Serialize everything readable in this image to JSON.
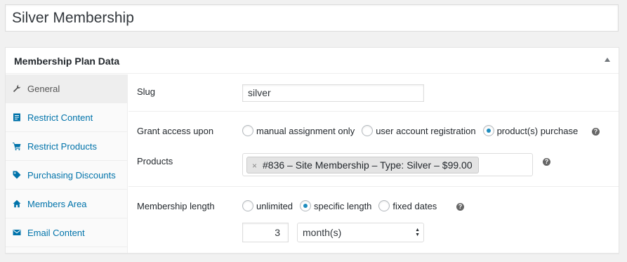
{
  "post_title": "Silver Membership",
  "metabox": {
    "title": "Membership Plan Data"
  },
  "tabs": [
    {
      "label": "General",
      "icon": "wrench-icon"
    },
    {
      "label": "Restrict Content",
      "icon": "document-icon"
    },
    {
      "label": "Restrict Products",
      "icon": "cart-icon"
    },
    {
      "label": "Purchasing Discounts",
      "icon": "tag-icon"
    },
    {
      "label": "Members Area",
      "icon": "home-icon"
    },
    {
      "label": "Email Content",
      "icon": "email-icon"
    }
  ],
  "general": {
    "slug_label": "Slug",
    "slug_value": "silver",
    "grant_label": "Grant access upon",
    "grant_options": [
      "manual assignment only",
      "user account registration",
      "product(s) purchase"
    ],
    "grant_selected": "product(s) purchase",
    "products_label": "Products",
    "products_selected": [
      "#836 – Site Membership – Type: Silver – $99.00"
    ],
    "length_label": "Membership length",
    "length_options": [
      "unlimited",
      "specific length",
      "fixed dates"
    ],
    "length_selected": "specific length",
    "length_amount": "3",
    "length_period": "month(s)"
  },
  "help_glyph": "?",
  "remove_glyph": "×",
  "colors": {
    "link": "#0073aa",
    "radio_checked": "#1e8cbe",
    "background": "#f1f1f1"
  }
}
